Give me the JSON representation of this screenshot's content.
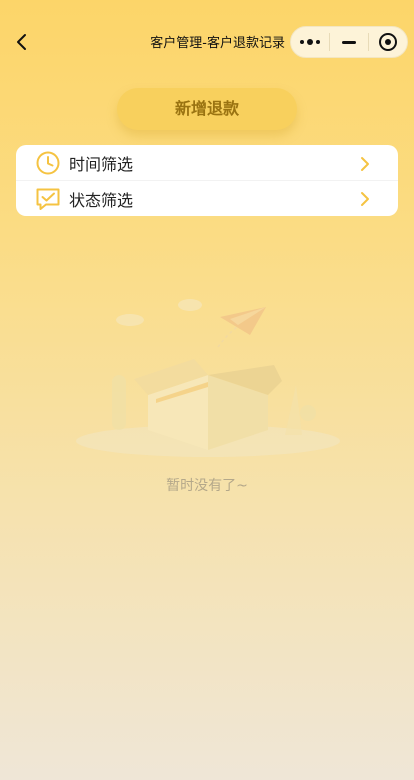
{
  "navbar": {
    "title": "客户管理-客户退款记录",
    "icons": {
      "back": "chevron-left-icon",
      "more": "more-dots-icon",
      "minimize": "minus-icon",
      "close": "target-circle-icon"
    }
  },
  "actions": {
    "add_refund_label": "新增退款"
  },
  "filters": {
    "items": [
      {
        "label": "时间筛选",
        "icon": "clock-icon"
      },
      {
        "label": "状态筛选",
        "icon": "chat-check-icon"
      }
    ]
  },
  "empty_state": {
    "message": "暂时没有了~"
  },
  "colors": {
    "accent": "#f5c342",
    "button_bg": "#f8d05d",
    "button_text": "#9a7311",
    "empty_text": "#b4a88a"
  }
}
